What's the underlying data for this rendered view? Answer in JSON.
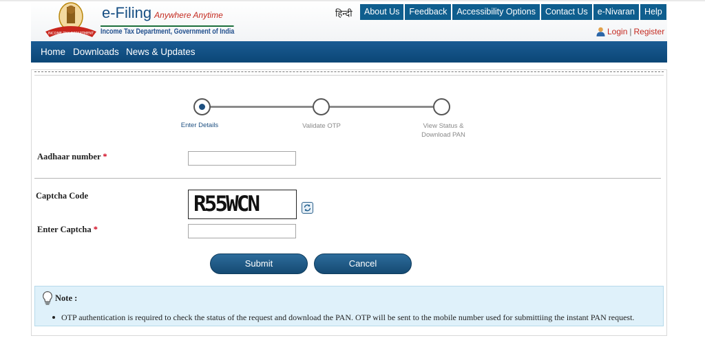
{
  "header": {
    "brand": "e-Filing",
    "tagline": "Anywhere Anytime",
    "department": "Income Tax Department, Government of India",
    "language_link": "हिन्दी",
    "top_links": [
      "About Us",
      "Feedback",
      "Accessibility Options",
      "Contact Us",
      "e-Nivaran",
      "Help"
    ],
    "login": "Login",
    "separator": "|",
    "register": "Register"
  },
  "nav": {
    "items": [
      "Home",
      "Downloads",
      "News & Updates"
    ]
  },
  "steps": [
    {
      "label": "Enter Details",
      "state": "current"
    },
    {
      "label": "Validate OTP",
      "state": "pending"
    },
    {
      "label_line1": "View Status &",
      "label_line2": "Download PAN",
      "state": "pending"
    }
  ],
  "form": {
    "aadhaar_label": "Aadhaar number",
    "aadhaar_value": "",
    "required_mark": "*",
    "captcha_label": "Captcha Code",
    "captcha_text": "R55WCN",
    "enter_captcha_label": "Enter Captcha",
    "enter_captcha_value": ""
  },
  "buttons": {
    "submit": "Submit",
    "cancel": "Cancel"
  },
  "note": {
    "title": "Note :",
    "items": [
      "OTP authentication is required to check the status of the request and download the PAN. OTP will be sent to the mobile number used for submittiing the instant PAN request."
    ]
  },
  "colors": {
    "brand_blue": "#0f5e8e",
    "nav_blue": "#0b4676",
    "accent_red": "#c4291f",
    "note_bg": "#dff1fa"
  },
  "icons": [
    "emblem-logo",
    "user-icon",
    "refresh-captcha-icon",
    "lightbulb-icon"
  ]
}
